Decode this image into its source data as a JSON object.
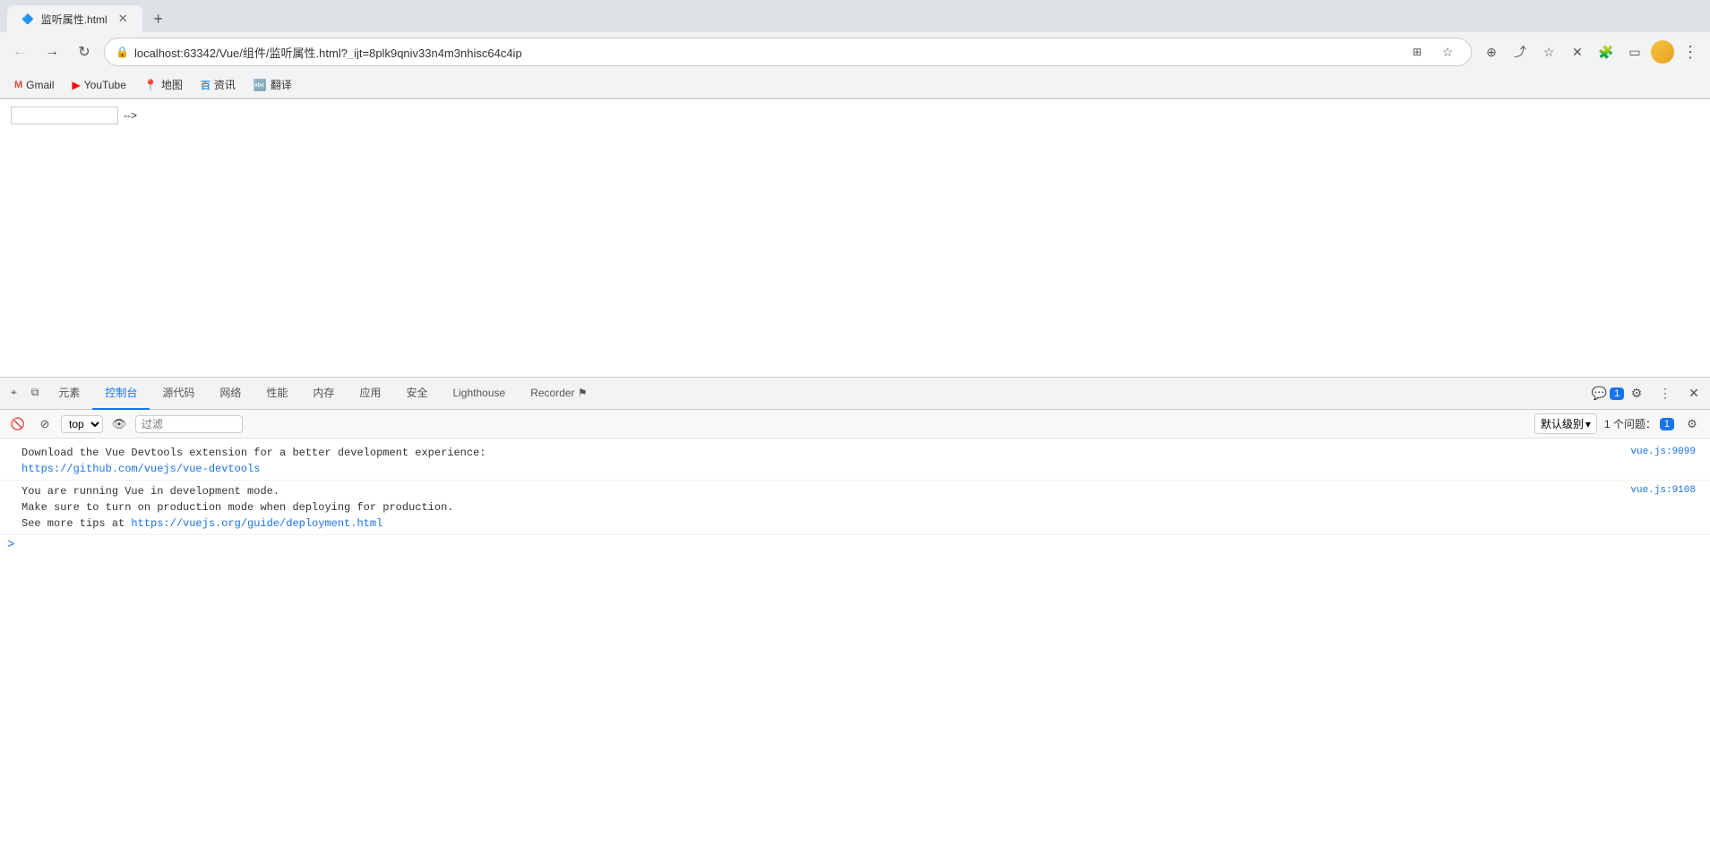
{
  "browser": {
    "url": "localhost:63342/Vue/组件/监听属性.html?_ijt=8plk9qniv33n4m3nhisc64c4ip",
    "tab_title": "监听属性.html"
  },
  "bookmarks": [
    {
      "id": "gmail",
      "label": "Gmail",
      "icon": "G"
    },
    {
      "id": "youtube",
      "label": "YouTube",
      "icon": "▶"
    },
    {
      "id": "maps",
      "label": "地图",
      "icon": "📍"
    },
    {
      "id": "baidu",
      "label": "资讯",
      "icon": "百"
    },
    {
      "id": "translate",
      "label": "翻译",
      "icon": "译"
    }
  ],
  "page": {
    "input_placeholder": "",
    "comment_text": "-->"
  },
  "devtools": {
    "tabs": [
      {
        "id": "elements",
        "label": "元素",
        "active": false
      },
      {
        "id": "console",
        "label": "控制台",
        "active": true
      },
      {
        "id": "sources",
        "label": "源代码",
        "active": false
      },
      {
        "id": "network",
        "label": "网络",
        "active": false
      },
      {
        "id": "performance",
        "label": "性能",
        "active": false
      },
      {
        "id": "memory",
        "label": "内存",
        "active": false
      },
      {
        "id": "application",
        "label": "应用",
        "active": false
      },
      {
        "id": "security",
        "label": "安全",
        "active": false
      },
      {
        "id": "lighthouse",
        "label": "Lighthouse",
        "active": false
      },
      {
        "id": "recorder",
        "label": "Recorder",
        "active": false
      }
    ],
    "badge_count": "1",
    "console": {
      "top_select": "top",
      "filter_placeholder": "过滤",
      "default_level": "默认级别",
      "issues_text": "1 个问题：",
      "issues_count": "1",
      "messages": [
        {
          "id": "msg1",
          "text": "Download the Vue Devtools extension for a better development experience:",
          "link": "https://github.com/vuejs/vue-devtools",
          "link_text": "https://github.com/vuejs/vue-devtools",
          "source": "vue.js:9099"
        },
        {
          "id": "msg2",
          "text1": "You are running Vue in development mode.",
          "text2": "Make sure to turn on production mode when deploying for production.",
          "text3": "See more tips at ",
          "link": "https://vuejs.org/guide/deployment.html",
          "link_text": "https://vuejs.org/guide/deployment.html",
          "source": "vue.js:9108"
        }
      ]
    }
  }
}
